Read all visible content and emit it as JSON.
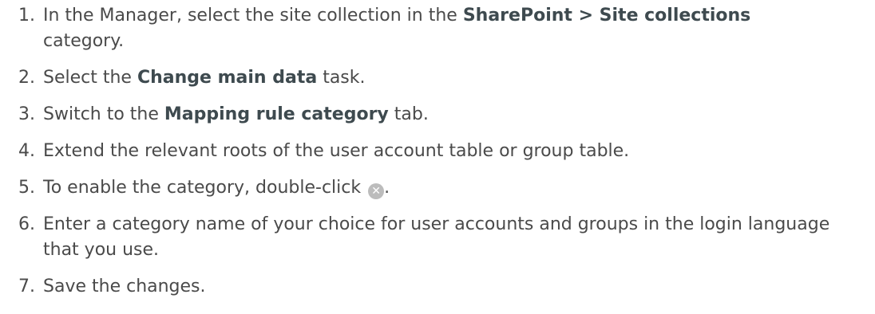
{
  "steps": [
    {
      "num": "1.",
      "pre": "In the Manager, select the site collection in the ",
      "bold": "SharePoint > Site collections",
      "post": " category."
    },
    {
      "num": "2.",
      "pre": "Select the ",
      "bold": "Change main data",
      "post": " task."
    },
    {
      "num": "3.",
      "pre": "Switch to the ",
      "bold": "Mapping rule category",
      "post": " tab."
    },
    {
      "num": "4.",
      "text": "Extend the relevant roots of the user account table or group table."
    },
    {
      "num": "5.",
      "pre": "To enable the category, double-click ",
      "icon": "close-circle-icon",
      "post": "."
    },
    {
      "num": "6.",
      "text": "Enter a category name of your choice for user accounts and groups in the login language that you use."
    },
    {
      "num": "7.",
      "text": "Save the changes."
    }
  ],
  "icon_glyph": "✕"
}
